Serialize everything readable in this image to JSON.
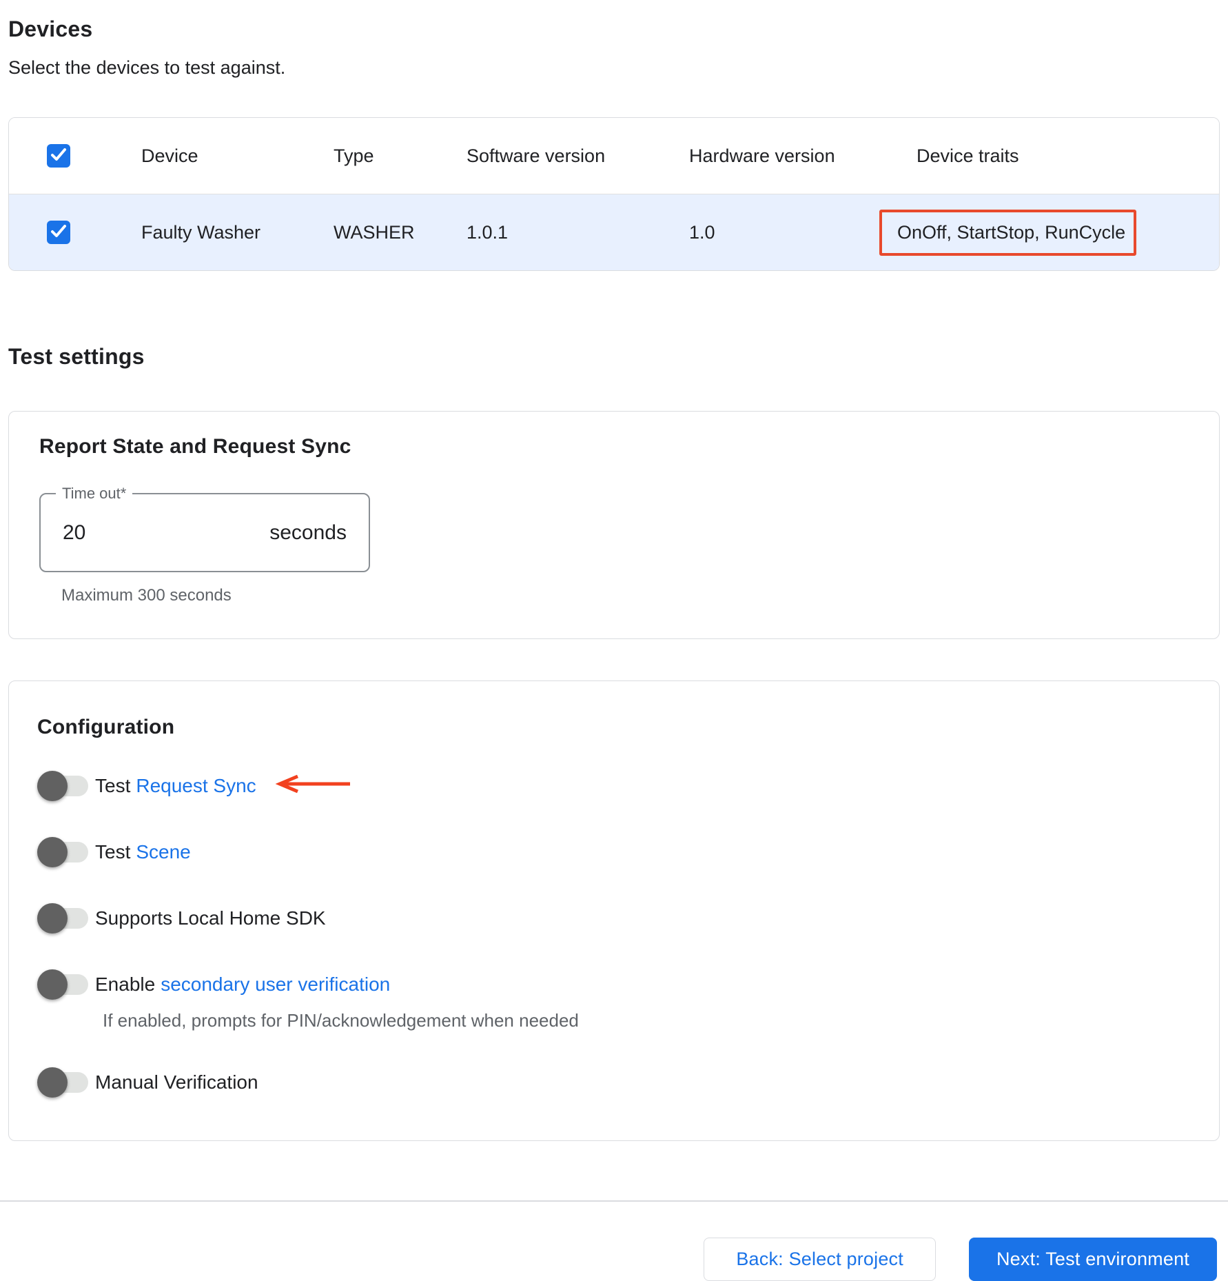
{
  "page": {
    "heading": "Devices",
    "subheading": "Select the devices to test against."
  },
  "devices_table": {
    "header_checkbox_checked": true,
    "columns": [
      "Device",
      "Type",
      "Software version",
      "Hardware version",
      "Device traits"
    ],
    "rows": [
      {
        "checked": true,
        "device": "Faulty Washer",
        "type": "WASHER",
        "software_version": "1.0.1",
        "hardware_version": "1.0",
        "device_traits": "OnOff, StartStop, RunCycle",
        "traits_highlighted": true
      }
    ]
  },
  "test_settings": {
    "heading": "Test settings",
    "report_state_card": {
      "title": "Report State and Request Sync",
      "timeout_field": {
        "label": "Time out*",
        "value": "20",
        "suffix": "seconds",
        "helper": "Maximum 300 seconds"
      }
    },
    "configuration_card": {
      "title": "Configuration",
      "toggles": [
        {
          "text": "Test",
          "link": "Request Sync",
          "enabled": false,
          "annotated_with_arrow": true
        },
        {
          "text": "Test",
          "link": "Scene",
          "enabled": false
        },
        {
          "text": "Supports Local Home SDK",
          "link": "",
          "enabled": false
        },
        {
          "text": "Enable",
          "link": "secondary user verification",
          "caption": "If enabled, prompts for PIN/acknowledgement when needed",
          "enabled": false
        },
        {
          "text": "Manual Verification",
          "link": "",
          "enabled": false
        }
      ]
    }
  },
  "footer": {
    "back_label": "Back: Select project",
    "next_label": "Next: Test environment"
  },
  "colors": {
    "accent_blue": "#1a73e8",
    "row_highlight_blue": "#e8f0fe",
    "annotation_box_red": "#e8492c",
    "annotation_arrow_red": "#f2411f",
    "text_primary": "#202124",
    "text_secondary": "#5f6368",
    "border_gray": "#dadce0",
    "toggle_thumb_gray": "#616161",
    "toggle_track_gray": "#e1e3e1"
  }
}
